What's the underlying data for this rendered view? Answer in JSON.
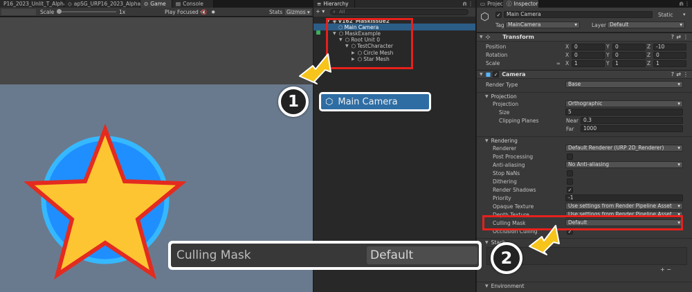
{
  "colors": {
    "scene_bg": "#6a7a8e",
    "star_fill": "#fdc532",
    "star_stroke": "#e32b20",
    "circle_fill": "#1f8fff",
    "circle_stroke": "#36b8ff",
    "highlight": "#e8201c",
    "arrow": "#f7c41b",
    "selection": "#2c5d87"
  },
  "tabs_left": [
    "P16_2023_Unlit_T_Alpha",
    "apSG_URP16_2023_AlphaMask",
    "Game",
    "Console"
  ],
  "tabs_mid": [
    "Hierarchy"
  ],
  "tabs_right": [
    "Project",
    "Inspector"
  ],
  "game_toolbar": {
    "scale_label": "Scale",
    "scale_value": "1x",
    "play_focused": "Play Focused",
    "stats": "Stats",
    "gizmos": "Gizmos"
  },
  "hierarchy": {
    "add_button": "+ ▾",
    "search_placeholder": "All",
    "items": [
      {
        "label": "V162_MaskIssue2"
      },
      {
        "label": "Main Camera"
      },
      {
        "label": "MaskExample"
      },
      {
        "label": "Root Unit 0"
      },
      {
        "label": "TestCharacter"
      },
      {
        "label": "Circle Mesh"
      },
      {
        "label": "Star Mesh"
      }
    ]
  },
  "callout1": {
    "number": "1",
    "label": "Main Camera"
  },
  "callout2": {
    "number": "2",
    "label": "Culling Mask",
    "value": "Default"
  },
  "inspector": {
    "object_name": "Main Camera",
    "static_label": "Static",
    "tag_label": "Tag",
    "tag_value": "MainCamera",
    "layer_label": "Layer",
    "layer_value": "Default",
    "transform": {
      "title": "Transform",
      "rows": [
        {
          "label": "Position",
          "x": "0",
          "y": "0",
          "z": "-10"
        },
        {
          "label": "Rotation",
          "x": "0",
          "y": "0",
          "z": "0"
        },
        {
          "label": "Scale",
          "x": "1",
          "y": "1",
          "z": "1"
        }
      ]
    },
    "camera": {
      "title": "Camera",
      "render_type_label": "Render Type",
      "render_type_value": "Base",
      "projection_section": "Projection",
      "projection_label": "Projection",
      "projection_value": "Orthographic",
      "size_label": "Size",
      "size_value": "5",
      "clipping_label": "Clipping Planes",
      "near_label": "Near",
      "near_value": "0.3",
      "far_label": "Far",
      "far_value": "1000",
      "rendering_section": "Rendering",
      "renderer_label": "Renderer",
      "renderer_value": "Default Renderer (URP 2D_Renderer)",
      "post_label": "Post Processing",
      "aa_label": "Anti-aliasing",
      "aa_value": "No Anti-aliasing",
      "stopnans_label": "Stop NaNs",
      "dithering_label": "Dithering",
      "shadows_label": "Render Shadows",
      "priority_label": "Priority",
      "priority_value": "-1",
      "opaque_label": "Opaque Texture",
      "opaque_value": "Use settings from Render Pipeline Asset",
      "depth_label": "Depth Texture",
      "depth_value": "Use settings from Render Pipeline Asset",
      "culling_label": "Culling Mask",
      "culling_value": "Default",
      "occlusion_label": "Occlusion Culling",
      "stack_section": "Stack",
      "stack_buttons": "+  −",
      "environment_section": "Environment"
    }
  }
}
